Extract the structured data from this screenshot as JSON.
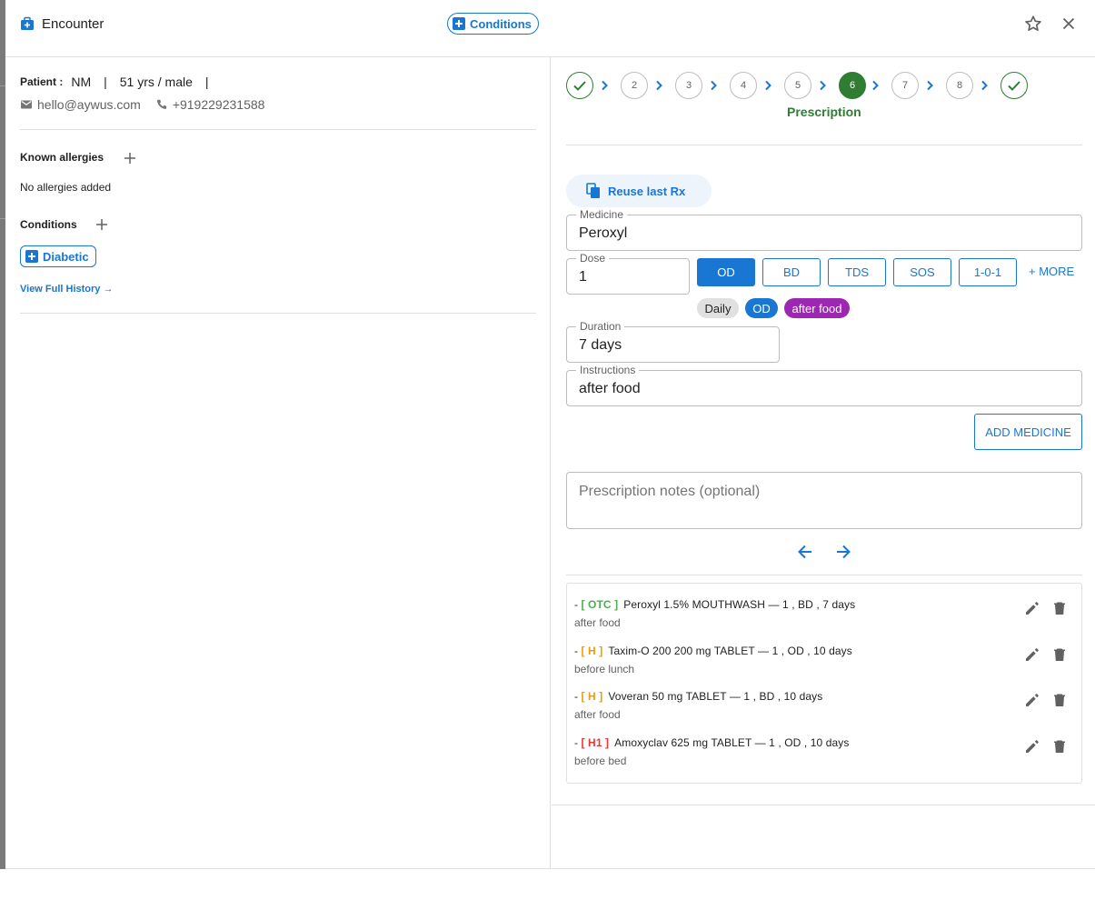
{
  "header": {
    "title": "Encounter",
    "conditions_chip": "Conditions"
  },
  "patient": {
    "label": "Patient :",
    "initials": "NM",
    "age_sex": "51 yrs / male",
    "email": "hello@aywus.com",
    "phone": "+919229231588"
  },
  "allergies": {
    "title": "Known allergies",
    "empty_text": "No allergies added"
  },
  "conditions": {
    "title": "Conditions",
    "items": [
      "Diabetic"
    ]
  },
  "history_link": "View Full History →",
  "stepper": {
    "steps": [
      "done",
      "2",
      "3",
      "4",
      "5",
      "6",
      "7",
      "8",
      "done"
    ],
    "active_step": "6",
    "active_label": "Prescription",
    "colors": {
      "active": "#2e7d32",
      "chevron": "#1976d2"
    }
  },
  "form": {
    "reuse_label": "Reuse last Rx",
    "medicine_label": "Medicine",
    "medicine_value": "Peroxyl",
    "dose_label": "Dose",
    "dose_value": "1",
    "frequencies": [
      "OD",
      "BD",
      "TDS",
      "SOS",
      "1-0-1"
    ],
    "selected_frequency": "OD",
    "more_label": "+ MORE",
    "pills": [
      "Daily",
      "OD",
      "after food"
    ],
    "duration_label": "Duration",
    "duration_value": "7 days",
    "instructions_label": "Instructions",
    "instructions_value": "after food",
    "add_medicine_label": "ADD MEDICINE",
    "notes_placeholder": "Prescription notes (optional)"
  },
  "prescriptions": [
    {
      "tag": "[ OTC ]",
      "tag_color": "#4caf50",
      "text": "Peroxyl 1.5% MOUTHWASH — 1 , BD , 7 days",
      "note": "after food"
    },
    {
      "tag": "[ H ]",
      "tag_color": "#f09d00",
      "text": "Taxim-O 200 200 mg TABLET — 1 , OD , 10 days",
      "note": "before lunch"
    },
    {
      "tag": "[ H ]",
      "tag_color": "#f09d00",
      "text": "Voveran 50 mg TABLET — 1 , BD , 10 days",
      "note": "after food"
    },
    {
      "tag": "[ H1 ]",
      "tag_color": "#e53935",
      "text": "Amoxyclav 625 mg TABLET — 1 , OD , 10 days",
      "note": "before bed"
    }
  ]
}
